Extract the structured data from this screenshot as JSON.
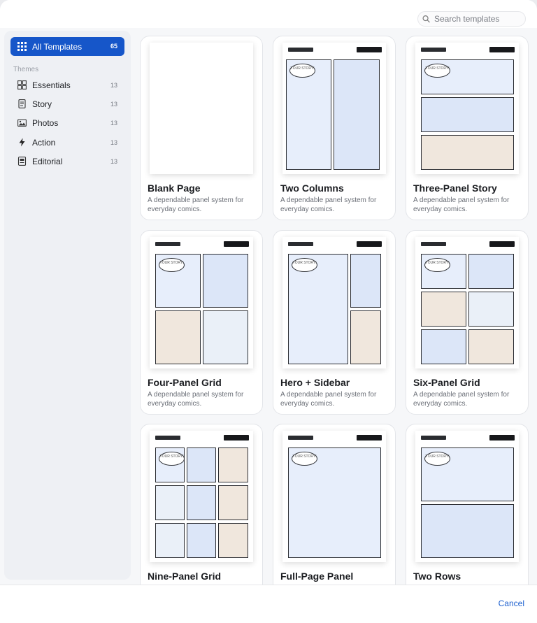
{
  "search": {
    "placeholder": "Search templates"
  },
  "sidebar": {
    "active": {
      "label": "All Templates",
      "count": "65"
    },
    "section_label": "Themes",
    "items": [
      {
        "label": "Essentials",
        "count": "13",
        "icon": "grid-four-icon"
      },
      {
        "label": "Story",
        "count": "13",
        "icon": "document-icon"
      },
      {
        "label": "Photos",
        "count": "13",
        "icon": "photos-icon"
      },
      {
        "label": "Action",
        "count": "13",
        "icon": "bolt-icon"
      },
      {
        "label": "Editorial",
        "count": "13",
        "icon": "newspaper-icon"
      }
    ]
  },
  "templates": [
    {
      "name": "Blank Page",
      "desc": "A dependable panel system for everyday comics."
    },
    {
      "name": "Two Columns",
      "desc": "A dependable panel system for everyday comics."
    },
    {
      "name": "Three-Panel Story",
      "desc": "A dependable panel system for everyday comics."
    },
    {
      "name": "Four-Panel Grid",
      "desc": "A dependable panel system for everyday comics."
    },
    {
      "name": "Hero + Sidebar",
      "desc": "A dependable panel system for everyday comics."
    },
    {
      "name": "Six-Panel Grid",
      "desc": "A dependable panel system for everyday comics."
    },
    {
      "name": "Nine-Panel Grid",
      "desc": ""
    },
    {
      "name": "Full-Page Panel",
      "desc": ""
    },
    {
      "name": "Two Rows",
      "desc": ""
    }
  ],
  "bubble_text": "YOUR STORY!",
  "footer": {
    "cancel_label": "Cancel"
  },
  "colors": {
    "accent": "#1656c9",
    "link": "#1b5fcf"
  }
}
